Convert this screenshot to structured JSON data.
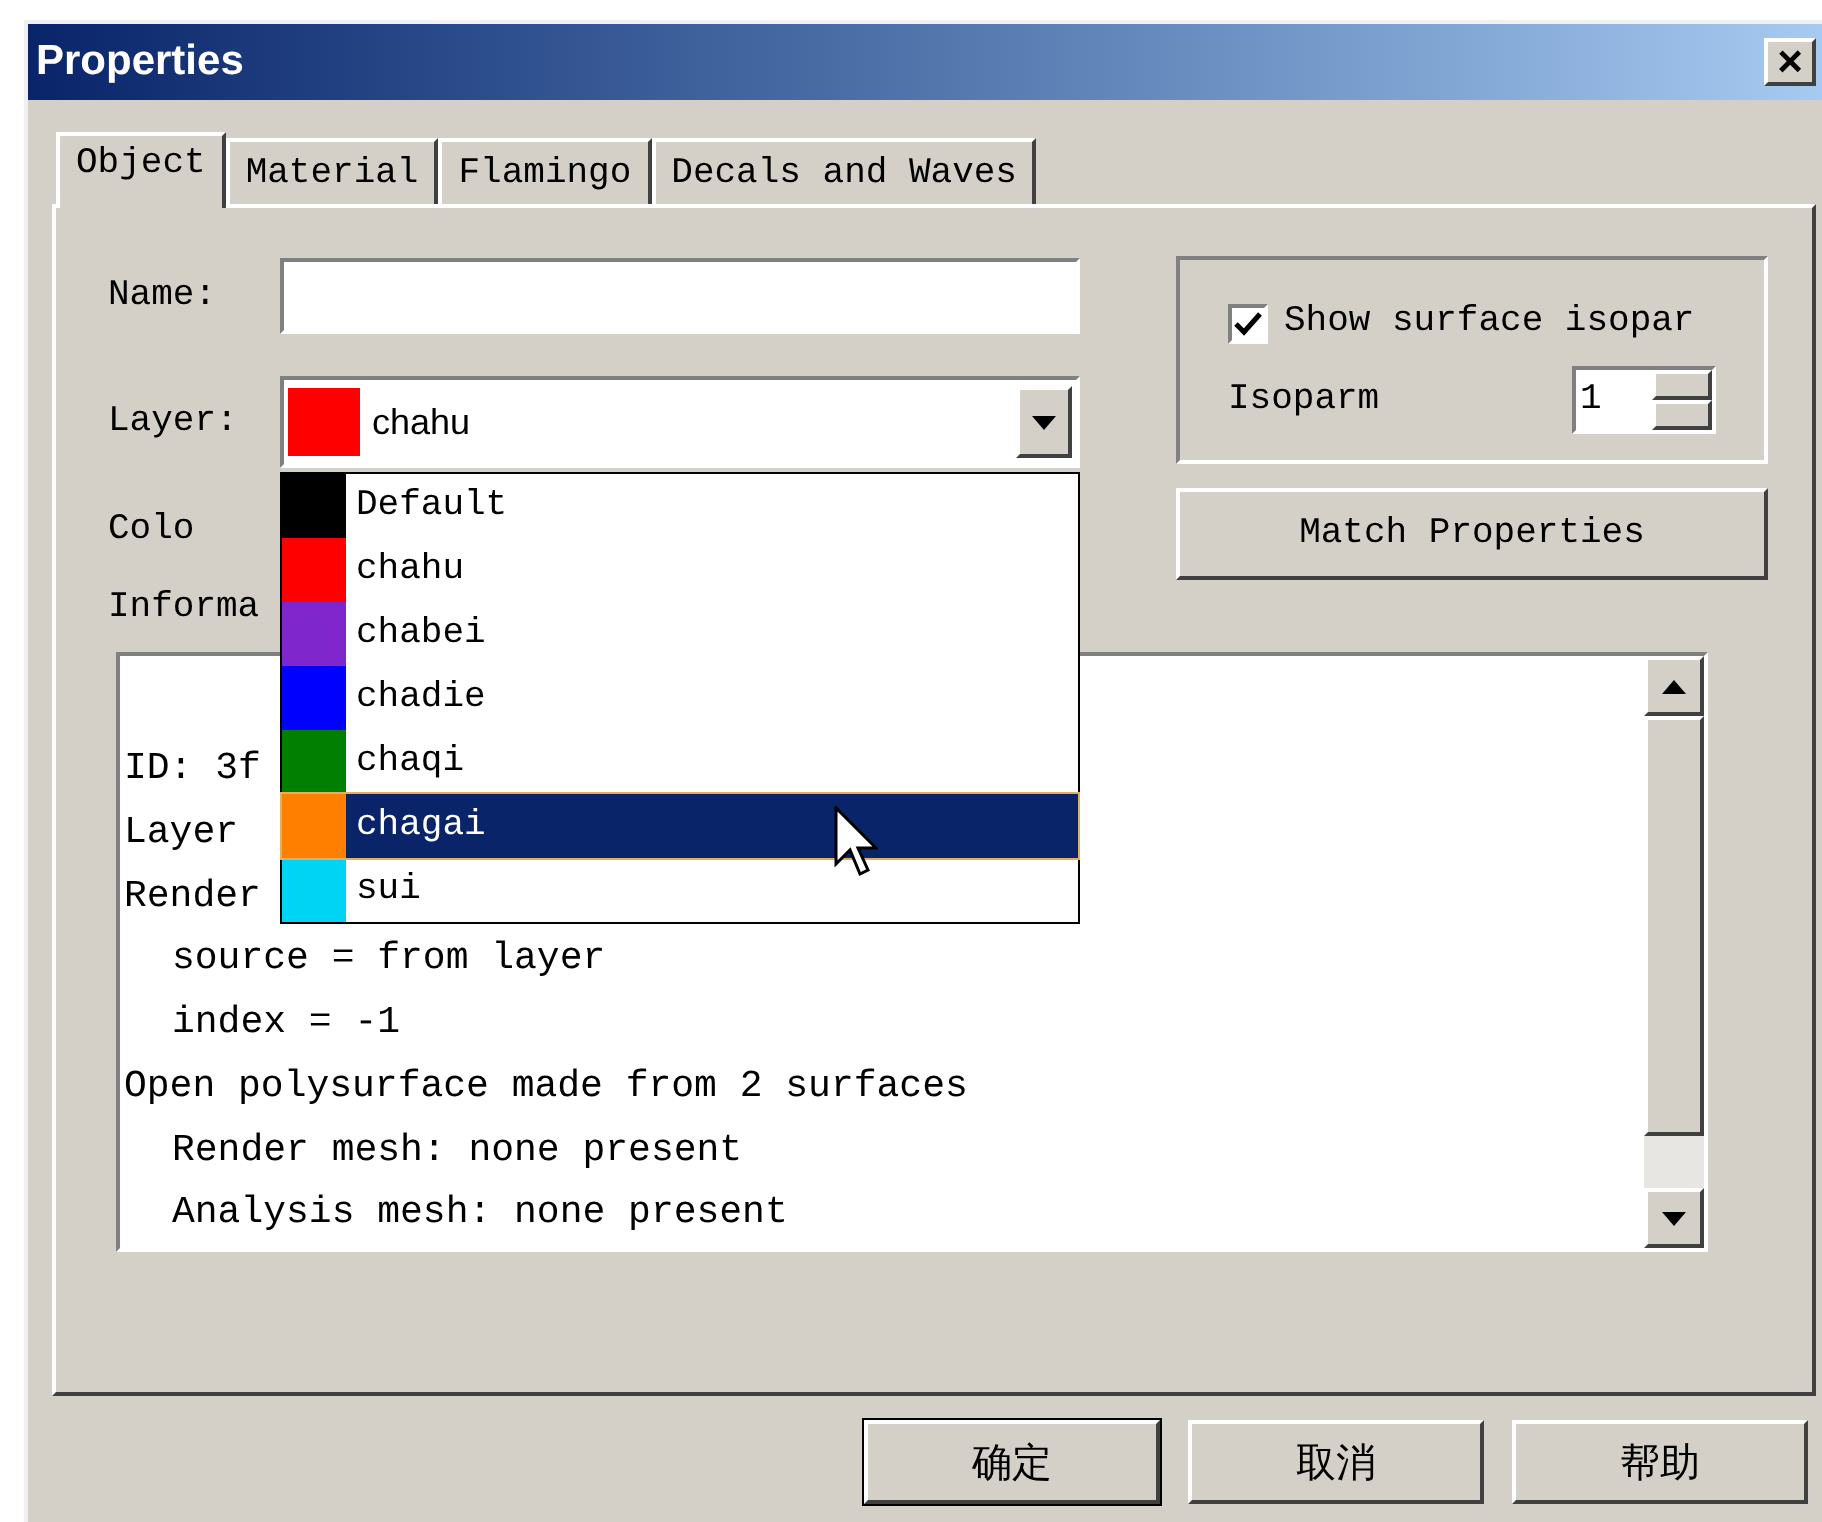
{
  "window": {
    "title": "Properties",
    "close": "×"
  },
  "tabs": [
    {
      "label": "Object",
      "selected": true
    },
    {
      "label": "Material",
      "selected": false
    },
    {
      "label": "Flamingo",
      "selected": false
    },
    {
      "label": "Decals and Waves",
      "selected": false
    }
  ],
  "name_field": {
    "label": "Name:"
  },
  "layer_field": {
    "label": "Layer:",
    "value": "chahu",
    "color": "#ff0000",
    "expanded": true
  },
  "layer_options": [
    {
      "name": "Default",
      "color": "#000000",
      "selected": false
    },
    {
      "name": "chahu",
      "color": "#ff0000",
      "selected": false
    },
    {
      "name": "chabei",
      "color": "#7f26cc",
      "selected": false
    },
    {
      "name": "chadie",
      "color": "#0000ff",
      "selected": false
    },
    {
      "name": "chaqi",
      "color": "#007f00",
      "selected": false
    },
    {
      "name": "chagai",
      "color": "#ff7f00",
      "selected": true
    },
    {
      "name": "sui",
      "color": "#00d4f5",
      "selected": false
    }
  ],
  "color_label": "Colo",
  "information_label": "Informa",
  "isoparm_group": {
    "show_label": "Show surface isopar",
    "checked": true,
    "isoparm_label": "Isoparm",
    "isoparm_value": "1"
  },
  "match_button": "Match Properties",
  "information_lines": [
    {
      "text": "ID: 3f",
      "indent": false
    },
    {
      "text": "Layer",
      "indent": false
    },
    {
      "text": "Render",
      "indent": false
    },
    {
      "text": "source = from layer",
      "indent": true
    },
    {
      "text": "index = -1",
      "indent": true
    },
    {
      "text": "Open polysurface made from 2 surfaces",
      "indent": false
    },
    {
      "text": "Render mesh: none present",
      "indent": true
    },
    {
      "text": "Analysis mesh: none present",
      "indent": true
    }
  ],
  "buttons": [
    {
      "label": "确定",
      "default": true
    },
    {
      "label": "取消",
      "default": false
    },
    {
      "label": "帮助",
      "default": false
    }
  ]
}
